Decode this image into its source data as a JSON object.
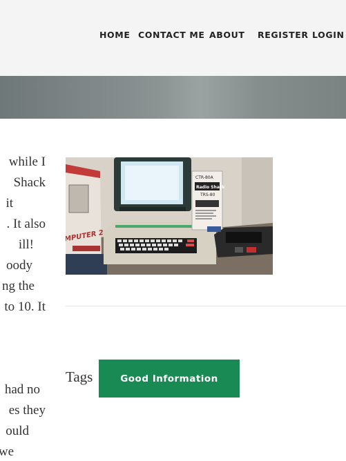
{
  "nav": {
    "items": [
      "HOME",
      "CONTACT ME",
      "ABOUT",
      "REGISTER",
      "LOGIN"
    ]
  },
  "article": {
    "lines": [
      "while I",
      "Shack",
      "it",
      ". It also",
      "ill!",
      "oody",
      "ng the",
      "to 10. It",
      "",
      "",
      "had no",
      "es they",
      "ould",
      "we"
    ]
  },
  "image": {
    "computer_label": "MPUTER 2",
    "box_labels": [
      "CTR-80A",
      "Radio Shack",
      "TRS-80"
    ]
  },
  "tags": {
    "label": "Tags",
    "items": [
      "Good Information"
    ]
  },
  "colors": {
    "tag_bg": "#1a8a55",
    "header_bg": "#f4f4f4",
    "banner": "#858d8d"
  }
}
